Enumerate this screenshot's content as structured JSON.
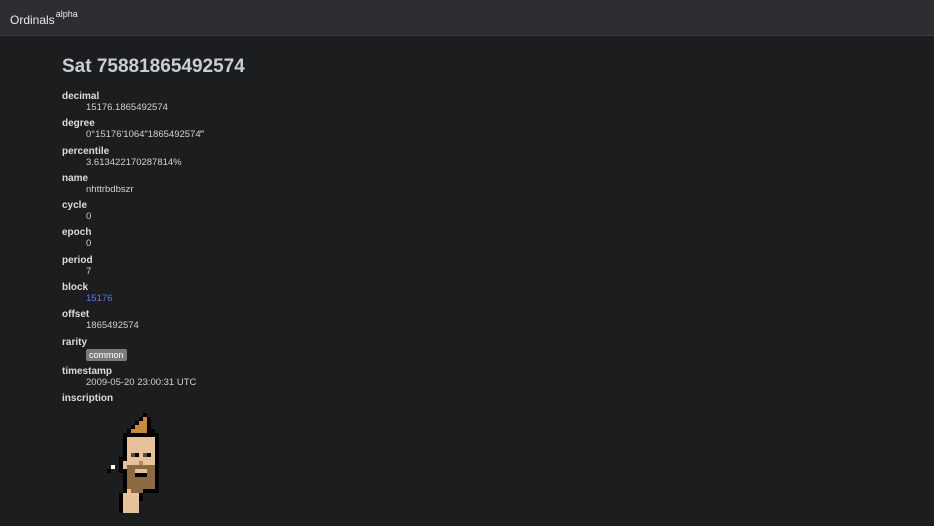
{
  "header": {
    "brand": "Ordinals",
    "brand_sup": "alpha"
  },
  "title": "Sat 75881865492574",
  "fields": {
    "decimal": {
      "label": "decimal",
      "value": "15176.1865492574"
    },
    "degree": {
      "label": "degree",
      "value": "0°15176′1064″1865492574‴"
    },
    "percentile": {
      "label": "percentile",
      "value": "3.613422170287814%"
    },
    "name": {
      "label": "name",
      "value": "nhttrbdbszr"
    },
    "cycle": {
      "label": "cycle",
      "value": "0"
    },
    "epoch": {
      "label": "epoch",
      "value": "0"
    },
    "period": {
      "label": "period",
      "value": "7"
    },
    "block": {
      "label": "block",
      "value": "15176"
    },
    "offset": {
      "label": "offset",
      "value": "1865492574"
    },
    "rarity": {
      "label": "rarity",
      "value": "common"
    },
    "timestamp": {
      "label": "timestamp",
      "value": "2009-05-20 23:00:31 UTC"
    },
    "inscription": {
      "label": "inscription"
    }
  },
  "colors": {
    "background": "#1c1d1f",
    "header": "#2c2e31",
    "link": "#4f7ef0",
    "rarity_badge": "#7b7b7b"
  }
}
